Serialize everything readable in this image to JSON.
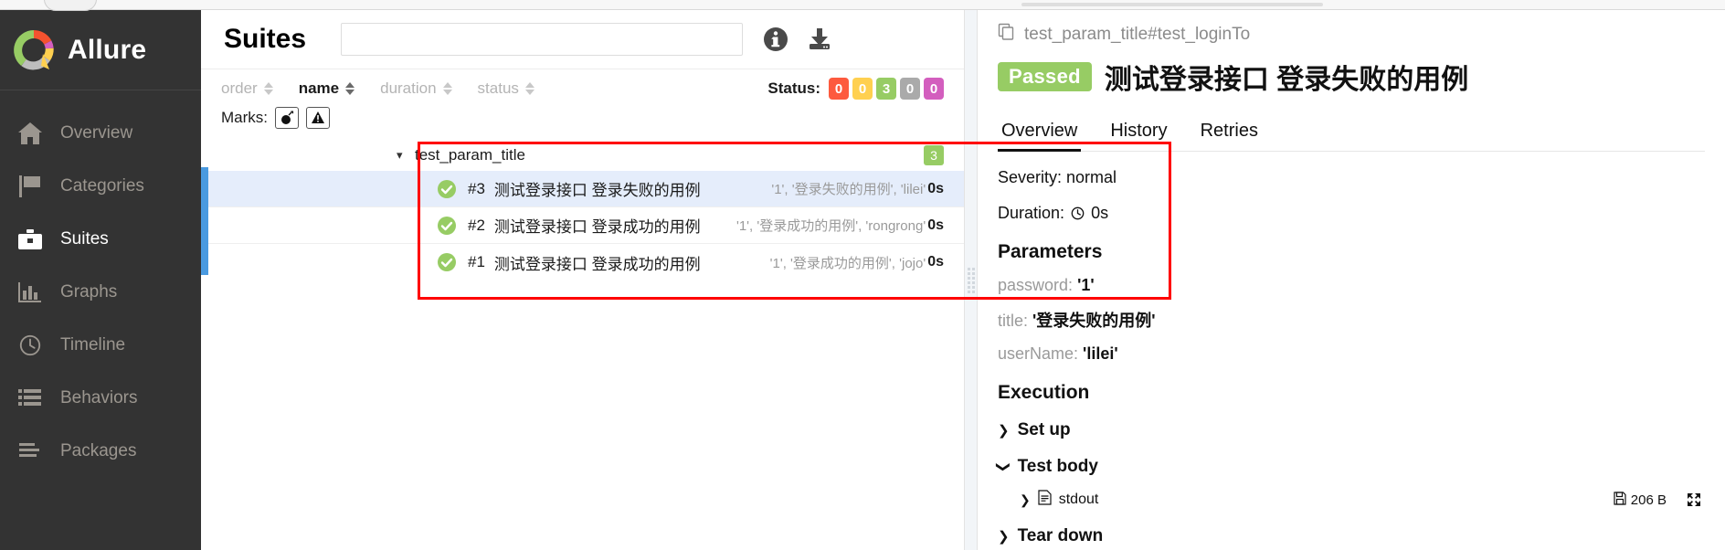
{
  "brand": {
    "name": "Allure",
    "logo_icon": "allure-donut-logo"
  },
  "sidebar": {
    "items": [
      {
        "label": "Overview",
        "icon": "home-icon",
        "active": false
      },
      {
        "label": "Categories",
        "icon": "flag-icon",
        "active": false
      },
      {
        "label": "Suites",
        "icon": "briefcase-icon",
        "active": true
      },
      {
        "label": "Graphs",
        "icon": "bar-chart-icon",
        "active": false
      },
      {
        "label": "Timeline",
        "icon": "clock-icon",
        "active": false
      },
      {
        "label": "Behaviors",
        "icon": "list-icon",
        "active": false
      },
      {
        "label": "Packages",
        "icon": "packages-icon",
        "active": false
      }
    ]
  },
  "left_panel": {
    "title": "Suites",
    "search": {
      "value": "",
      "placeholder": ""
    },
    "header_icons": [
      {
        "name": "info-icon"
      },
      {
        "name": "download-icon"
      }
    ],
    "sorters": [
      {
        "label": "order",
        "active": false
      },
      {
        "label": "name",
        "active": true
      },
      {
        "label": "duration",
        "active": false
      },
      {
        "label": "status",
        "active": false
      }
    ],
    "status_filter": {
      "label": "Status:",
      "chips": [
        {
          "value": "0",
          "color": "#fd5a3e",
          "state": "failed"
        },
        {
          "value": "0",
          "color": "#ffd050",
          "state": "broken"
        },
        {
          "value": "3",
          "color": "#97cc64",
          "state": "passed"
        },
        {
          "value": "0",
          "color": "#aaaaaa",
          "state": "skipped"
        },
        {
          "value": "0",
          "color": "#d35ebe",
          "state": "unknown"
        }
      ]
    },
    "marks": {
      "label": "Marks:",
      "buttons": [
        {
          "name": "flaky-bomb-icon"
        },
        {
          "name": "warning-triangle-icon"
        }
      ]
    },
    "suite": {
      "name": "test_param_title",
      "count": "3",
      "expanded": true,
      "tests": [
        {
          "num": "#3",
          "name": "测试登录接口 登录失败的用例",
          "params": "'1', '登录失败的用例', 'lilei'",
          "duration": "0s",
          "status": "passed",
          "selected": true
        },
        {
          "num": "#2",
          "name": "测试登录接口 登录成功的用例",
          "params": "'1', '登录成功的用例', 'rongrong'",
          "duration": "0s",
          "status": "passed",
          "selected": false
        },
        {
          "num": "#1",
          "name": "测试登录接口 登录成功的用例",
          "params": "'1', '登录成功的用例', 'jojo'",
          "duration": "0s",
          "status": "passed",
          "selected": false
        }
      ]
    }
  },
  "right_panel": {
    "breadcrumb": "test_param_title#test_loginTo",
    "breadcrumb_icon": "copy-icon",
    "status_badge": "Passed",
    "title": "测试登录接口 登录失败的用例",
    "tabs": [
      {
        "label": "Overview",
        "active": true
      },
      {
        "label": "History",
        "active": false
      },
      {
        "label": "Retries",
        "active": false
      }
    ],
    "severity": "Severity: normal",
    "duration_label": "Duration:",
    "duration_value": "0s",
    "parameters_heading": "Parameters",
    "parameters": [
      {
        "key": "password",
        "value": "'1'"
      },
      {
        "key": "title",
        "value": "'登录失败的用例'"
      },
      {
        "key": "userName",
        "value": "'lilei'"
      }
    ],
    "execution_heading": "Execution",
    "execution": [
      {
        "label": "Set up",
        "expanded": false
      },
      {
        "label": "Test body",
        "expanded": true
      },
      {
        "label": "Tear down",
        "expanded": false
      }
    ],
    "attachment": {
      "name": "stdout",
      "size": "206 B",
      "file_icon": "file-text-icon",
      "save_icon": "save-icon",
      "expand_icon": "fullscreen-icon"
    }
  }
}
